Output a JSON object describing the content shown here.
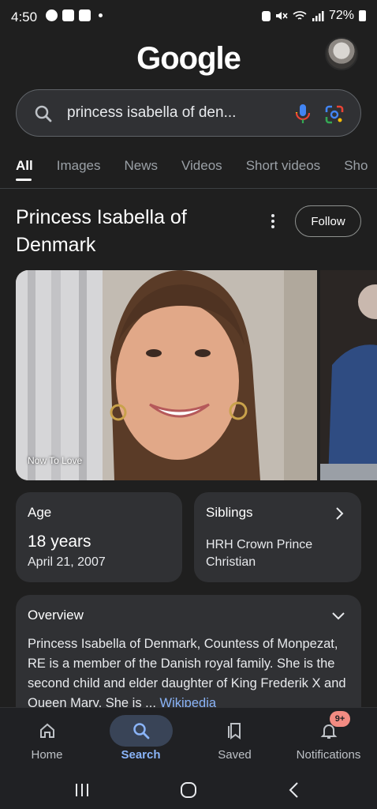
{
  "status_bar": {
    "time": "4:50",
    "battery": "72%"
  },
  "header": {
    "logo": "Google"
  },
  "search": {
    "query": "princess isabella of den..."
  },
  "tabs": [
    {
      "label": "All",
      "active": true
    },
    {
      "label": "Images"
    },
    {
      "label": "News"
    },
    {
      "label": "Videos"
    },
    {
      "label": "Short videos"
    },
    {
      "label": "Sho"
    }
  ],
  "knowledge_panel": {
    "title": "Princess Isabella of Denmark",
    "follow_label": "Follow",
    "image_source": "Now To Love",
    "age": {
      "label": "Age",
      "value": "18 years",
      "sub": "April 21, 2007"
    },
    "siblings": {
      "label": "Siblings",
      "value": "HRH Crown Prince Christian"
    },
    "overview": {
      "label": "Overview",
      "text": "Princess Isabella of Denmark, Countess of Monpezat, RE is a member of the Danish royal family. She is the second child and elder daughter of King Frederik X and Queen Mary. She is ... ",
      "link": "Wikipedia"
    }
  },
  "bottom_nav": {
    "items": [
      {
        "label": "Home",
        "icon": "home-icon"
      },
      {
        "label": "Search",
        "icon": "search-icon",
        "active": true
      },
      {
        "label": "Saved",
        "icon": "bookmark-icon"
      },
      {
        "label": "Notifications",
        "icon": "bell-icon"
      }
    ],
    "badge": "9+"
  },
  "colors": {
    "background": "#1f1f1f",
    "card": "#303134",
    "link": "#8ab4f8",
    "active_nav": "#394457",
    "badge": "#f28b82"
  }
}
